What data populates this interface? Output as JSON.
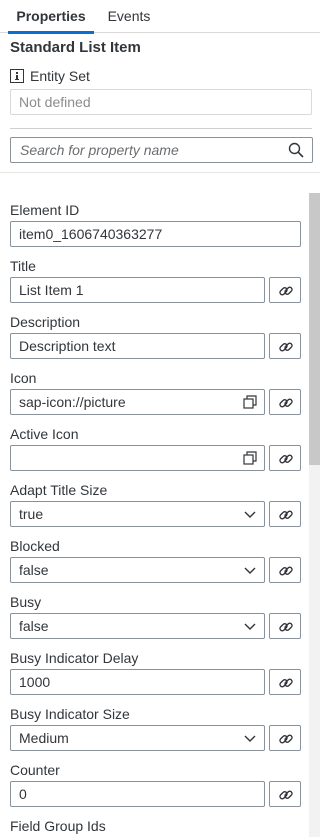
{
  "tabs": [
    {
      "label": "Properties",
      "active": true
    },
    {
      "label": "Events",
      "active": false
    }
  ],
  "panel": {
    "title": "Standard List Item",
    "entity_set_label": "Entity Set",
    "entity_set_value": "Not defined",
    "search_placeholder": "Search for property name"
  },
  "properties": [
    {
      "label": "Element ID",
      "value": "item0_1606740363277",
      "control": "text",
      "bindable": false
    },
    {
      "label": "Title",
      "value": "List Item 1",
      "control": "text",
      "bindable": true
    },
    {
      "label": "Description",
      "value": "Description text",
      "control": "text",
      "bindable": true
    },
    {
      "label": "Icon",
      "value": "sap-icon://picture",
      "control": "value-help",
      "bindable": true
    },
    {
      "label": "Active Icon",
      "value": "",
      "control": "value-help",
      "bindable": true
    },
    {
      "label": "Adapt Title Size",
      "value": "true",
      "control": "select",
      "bindable": true
    },
    {
      "label": "Blocked",
      "value": "false",
      "control": "select",
      "bindable": true
    },
    {
      "label": "Busy",
      "value": "false",
      "control": "select",
      "bindable": true
    },
    {
      "label": "Busy Indicator Delay",
      "value": "1000",
      "control": "text",
      "bindable": true
    },
    {
      "label": "Busy Indicator Size",
      "value": "Medium",
      "control": "select",
      "bindable": true
    },
    {
      "label": "Counter",
      "value": "0",
      "control": "text",
      "bindable": true
    },
    {
      "label": "Field Group Ids",
      "value": "",
      "control": "text",
      "bindable": true
    }
  ],
  "icons": {
    "info": "info-icon",
    "search": "search-icon",
    "value_help": "value-help-icon",
    "dropdown": "chevron-down-icon",
    "binding": "link-icon"
  },
  "colors": {
    "accent": "#0a6ed1",
    "text": "#32363a",
    "border": "#89919a",
    "placeholder": "#8c8c8c"
  }
}
